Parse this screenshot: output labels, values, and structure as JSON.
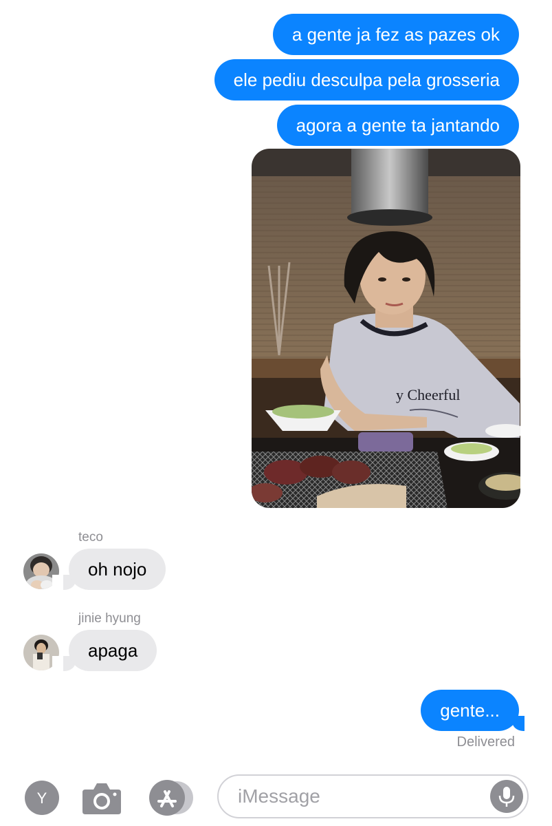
{
  "conversation": {
    "outgoing_top": [
      {
        "text": "a gente ja fez as pazes ok"
      },
      {
        "text": "ele pediu desculpa pela grosseria"
      },
      {
        "text": "agora a gente ta jantando"
      }
    ],
    "photo_shirt_text": "y Cheerful",
    "incoming": [
      {
        "sender": "teco",
        "text": "oh nojo",
        "avatar": "avatar-teco"
      },
      {
        "sender": "jinie hyung",
        "text": "apaga",
        "avatar": "avatar-jinie"
      }
    ],
    "outgoing_last": {
      "text": "gente..."
    },
    "status": "Delivered"
  },
  "compose": {
    "app_button_letter": "Y",
    "camera_icon": "camera-icon",
    "appstore_icon": "app-store-icon",
    "placeholder": "iMessage",
    "mic_icon": "microphone-icon"
  },
  "colors": {
    "outgoing_bubble": "#0b84ff",
    "incoming_bubble": "#e9e9eb",
    "meta_text": "#8e8e93"
  }
}
